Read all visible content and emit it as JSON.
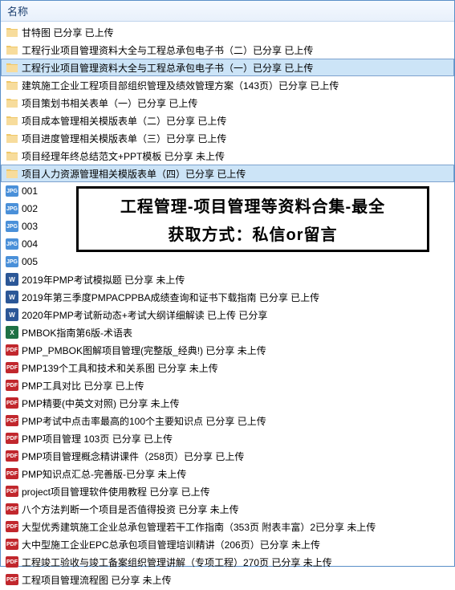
{
  "header": {
    "title": "名称"
  },
  "overlay": {
    "line1": "工程管理-项目管理等资料合集-最全",
    "line2": "获取方式：私信or留言"
  },
  "items": [
    {
      "type": "folder",
      "label": "甘特图 已分享 已上传"
    },
    {
      "type": "folder",
      "label": "工程行业项目管理资料大全与工程总承包电子书（二）已分享 已上传"
    },
    {
      "type": "folder",
      "label": "工程行业项目管理资料大全与工程总承包电子书（一）已分享 已上传",
      "selected": true
    },
    {
      "type": "folder",
      "label": "建筑施工企业工程项目部组织管理及绩效管理方案（143页）已分享 已上传"
    },
    {
      "type": "folder",
      "label": "项目策划书相关表单（一）已分享 已上传"
    },
    {
      "type": "folder",
      "label": "项目成本管理相关模版表单（二）已分享 已上传"
    },
    {
      "type": "folder",
      "label": "项目进度管理相关模版表单（三）已分享 已上传"
    },
    {
      "type": "folder",
      "label": "项目经理年终总结范文+PPT模板 已分享 未上传"
    },
    {
      "type": "folder",
      "label": "项目人力资源管理相关模版表单（四）已分享 已上传",
      "selected": true
    },
    {
      "type": "jpg",
      "label": "001"
    },
    {
      "type": "jpg",
      "label": "002"
    },
    {
      "type": "jpg",
      "label": "003"
    },
    {
      "type": "jpg",
      "label": "004"
    },
    {
      "type": "jpg",
      "label": "005"
    },
    {
      "type": "doc",
      "label": "2019年PMP考试模拟题 已分享 未上传"
    },
    {
      "type": "doc",
      "label": "2019年第三季度PMPACPPBA成绩查询和证书下载指南 已分享 已上传"
    },
    {
      "type": "doc",
      "label": "2020年PMP考试新动态+考试大纲详细解读 已上传 已分享"
    },
    {
      "type": "xls",
      "label": "PMBOK指南第6版-术语表"
    },
    {
      "type": "pdf",
      "label": "PMP_PMBOK图解项目管理(完整版_经典!) 已分享 未上传"
    },
    {
      "type": "pdf",
      "label": "PMP139个工具和技术和关系图 已分享 未上传"
    },
    {
      "type": "pdf",
      "label": "PMP工具对比 已分享 已上传"
    },
    {
      "type": "pdf",
      "label": "PMP精要(中英文对照) 已分享 未上传"
    },
    {
      "type": "pdf",
      "label": "PMP考试中点击率最高的100个主要知识点 已分享 已上传"
    },
    {
      "type": "pdf",
      "label": "PMP项目管理 103页 已分享 已上传"
    },
    {
      "type": "pdf",
      "label": "PMP项目管理概念精讲课件（258页）已分享 已上传"
    },
    {
      "type": "pdf",
      "label": "PMP知识点汇总-完善版-已分享 未上传"
    },
    {
      "type": "pdf",
      "label": "project项目管理软件使用教程 已分享 已上传"
    },
    {
      "type": "pdf",
      "label": "八个方法判断一个项目是否值得投资 已分享 未上传"
    },
    {
      "type": "pdf",
      "label": "大型优秀建筑施工企业总承包管理若干工作指南（353页 附表丰富）2已分享 未上传"
    },
    {
      "type": "pdf",
      "label": "大中型施工企业EPC总承包项目管理培训精讲（206页）已分享 未上传"
    },
    {
      "type": "pdf",
      "label": "工程竣工验收与竣工备案组织管理讲解（专项工程）270页 已分享 未上传"
    },
    {
      "type": "pdf",
      "label": "工程项目管理流程图 已分享 未上传"
    }
  ],
  "icon_text": {
    "jpg": "JPG",
    "doc": "W",
    "xls": "X",
    "pdf": "PDF"
  }
}
